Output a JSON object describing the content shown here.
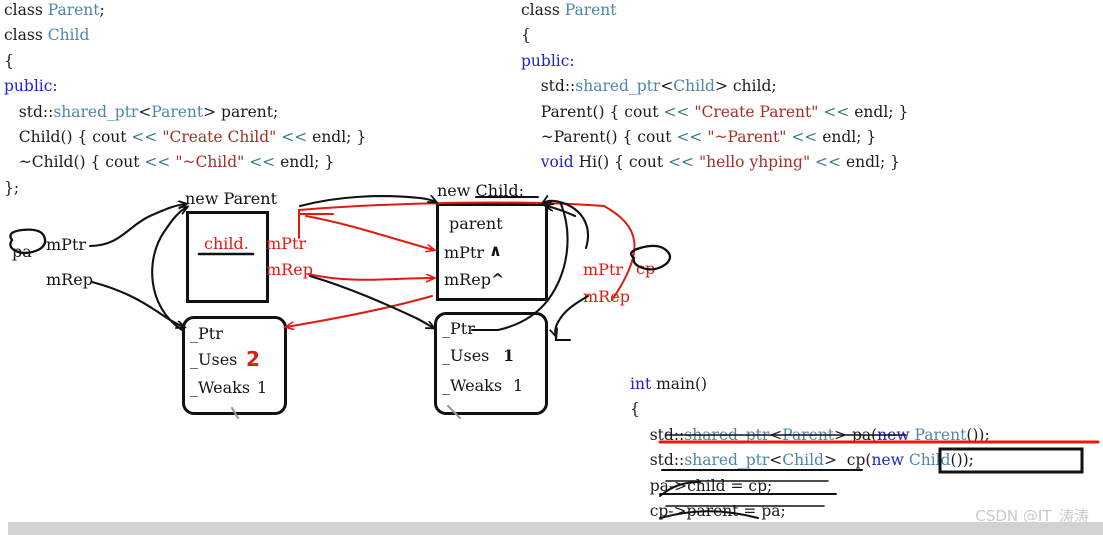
{
  "code_left": {
    "lines": [
      [
        {
          "t": "class ",
          "c": "pl"
        },
        {
          "t": "Parent",
          "c": "ty"
        },
        {
          "t": ";",
          "c": "pl"
        }
      ],
      [
        {
          "t": "class ",
          "c": "pl"
        },
        {
          "t": "Child",
          "c": "ty"
        }
      ],
      [
        {
          "t": "{",
          "c": "pl"
        }
      ],
      [
        {
          "t": "public:",
          "c": "kw"
        }
      ],
      [
        {
          "t": "   std::",
          "c": "pl"
        },
        {
          "t": "shared_ptr",
          "c": "ty"
        },
        {
          "t": "<",
          "c": "pl"
        },
        {
          "t": "Parent",
          "c": "ty"
        },
        {
          "t": "> parent;",
          "c": "pl"
        }
      ],
      [
        {
          "t": "   Child() { cout ",
          "c": "pl"
        },
        {
          "t": "<<",
          "c": "op"
        },
        {
          "t": " ",
          "c": "pl"
        },
        {
          "t": "\"Create Child\"",
          "c": "str"
        },
        {
          "t": " ",
          "c": "pl"
        },
        {
          "t": "<<",
          "c": "op"
        },
        {
          "t": " endl; }",
          "c": "pl"
        }
      ],
      [
        {
          "t": "   ~Child() { cout ",
          "c": "pl"
        },
        {
          "t": "<<",
          "c": "op"
        },
        {
          "t": " ",
          "c": "pl"
        },
        {
          "t": "\"~Child\"",
          "c": "str"
        },
        {
          "t": " ",
          "c": "pl"
        },
        {
          "t": "<<",
          "c": "op"
        },
        {
          "t": " endl; }",
          "c": "pl"
        }
      ],
      [
        {
          "t": "};",
          "c": "pl"
        }
      ]
    ]
  },
  "code_right": {
    "lines": [
      [
        {
          "t": "class ",
          "c": "pl"
        },
        {
          "t": "Parent",
          "c": "ty"
        }
      ],
      [
        {
          "t": "{",
          "c": "pl"
        }
      ],
      [
        {
          "t": "public:",
          "c": "kw"
        }
      ],
      [
        {
          "t": "    std::",
          "c": "pl"
        },
        {
          "t": "shared_ptr",
          "c": "ty"
        },
        {
          "t": "<",
          "c": "pl"
        },
        {
          "t": "Child",
          "c": "ty"
        },
        {
          "t": "> child;",
          "c": "pl"
        }
      ],
      [
        {
          "t": "    Parent() { cout ",
          "c": "pl"
        },
        {
          "t": "<<",
          "c": "op"
        },
        {
          "t": " ",
          "c": "pl"
        },
        {
          "t": "\"Create Parent\"",
          "c": "str"
        },
        {
          "t": " ",
          "c": "pl"
        },
        {
          "t": "<<",
          "c": "op"
        },
        {
          "t": " endl; }",
          "c": "pl"
        }
      ],
      [
        {
          "t": "    ~Parent() { cout ",
          "c": "pl"
        },
        {
          "t": "<<",
          "c": "op"
        },
        {
          "t": " ",
          "c": "pl"
        },
        {
          "t": "\"~Parent\"",
          "c": "str"
        },
        {
          "t": " ",
          "c": "pl"
        },
        {
          "t": "<<",
          "c": "op"
        },
        {
          "t": " endl; }",
          "c": "pl"
        }
      ],
      [
        {
          "t": "    ",
          "c": "pl"
        },
        {
          "t": "void",
          "c": "kw"
        },
        {
          "t": " Hi() { cout ",
          "c": "pl"
        },
        {
          "t": "<<",
          "c": "op"
        },
        {
          "t": " ",
          "c": "pl"
        },
        {
          "t": "\"hello yhping\"",
          "c": "str"
        },
        {
          "t": " ",
          "c": "pl"
        },
        {
          "t": "<<",
          "c": "op"
        },
        {
          "t": " endl; }",
          "c": "pl"
        }
      ]
    ]
  },
  "code_main": {
    "lines": [
      [
        {
          "t": "int",
          "c": "kw"
        },
        {
          "t": " main()",
          "c": "pl"
        }
      ],
      [
        {
          "t": "{",
          "c": "pl"
        }
      ],
      [
        {
          "t": "    std::",
          "c": "pl"
        },
        {
          "t": "shared_ptr",
          "c": "ty"
        },
        {
          "t": "<",
          "c": "pl"
        },
        {
          "t": "Parent",
          "c": "ty"
        },
        {
          "t": "> pa(",
          "c": "pl"
        },
        {
          "t": "new",
          "c": "kw"
        },
        {
          "t": " ",
          "c": "pl"
        },
        {
          "t": "Parent",
          "c": "ty"
        },
        {
          "t": "());",
          "c": "pl"
        }
      ],
      [
        {
          "t": "    std::",
          "c": "pl"
        },
        {
          "t": "shared_ptr",
          "c": "ty"
        },
        {
          "t": "<",
          "c": "pl"
        },
        {
          "t": "Child",
          "c": "ty"
        },
        {
          "t": ">  cp(",
          "c": "pl"
        },
        {
          "t": "new",
          "c": "kw"
        },
        {
          "t": " ",
          "c": "pl"
        },
        {
          "t": "Child",
          "c": "ty"
        },
        {
          "t": "());",
          "c": "pl"
        }
      ],
      [
        {
          "t": "    pa->child = cp;",
          "c": "pl"
        }
      ],
      [
        {
          "t": "    cp->parent = pa;",
          "c": "pl"
        }
      ]
    ]
  },
  "diagram": {
    "parent_object": {
      "caption": "new Parent",
      "field_child": "child.",
      "field_mptr": "mPtr",
      "field_mrep": "mRep"
    },
    "child_object": {
      "caption": "new Child:",
      "field_parent": "parent",
      "field_mptr": "mPtr",
      "field_mrep": "mRep",
      "caret_mptr": "∧",
      "caret_mrep": "^"
    },
    "pa_var": {
      "name": "pa",
      "mptr": "mPtr",
      "mrep": "mRep"
    },
    "cp_var": {
      "name": "cp",
      "mptr": "mPtr",
      "mrep": "mRep"
    },
    "parent_ctrl": {
      "ptr": "_Ptr",
      "uses_label": "_Uses",
      "uses_value": "2",
      "weaks_label": "_Weaks",
      "weaks_value": "1"
    },
    "child_ctrl": {
      "ptr": "_Ptr",
      "uses_label": "_Uses",
      "uses_value": "1",
      "weaks_label": "_Weaks",
      "weaks_value": "1"
    }
  },
  "colors": {
    "annotation_red": "#e01b10",
    "annotation_black": "#111111",
    "type_blue": "#4f87a8",
    "keyword_blue": "#2222cc",
    "string_red": "#a33028",
    "operator_teal": "#3c7c88"
  },
  "watermark": "CSDN @IT_涛涛"
}
